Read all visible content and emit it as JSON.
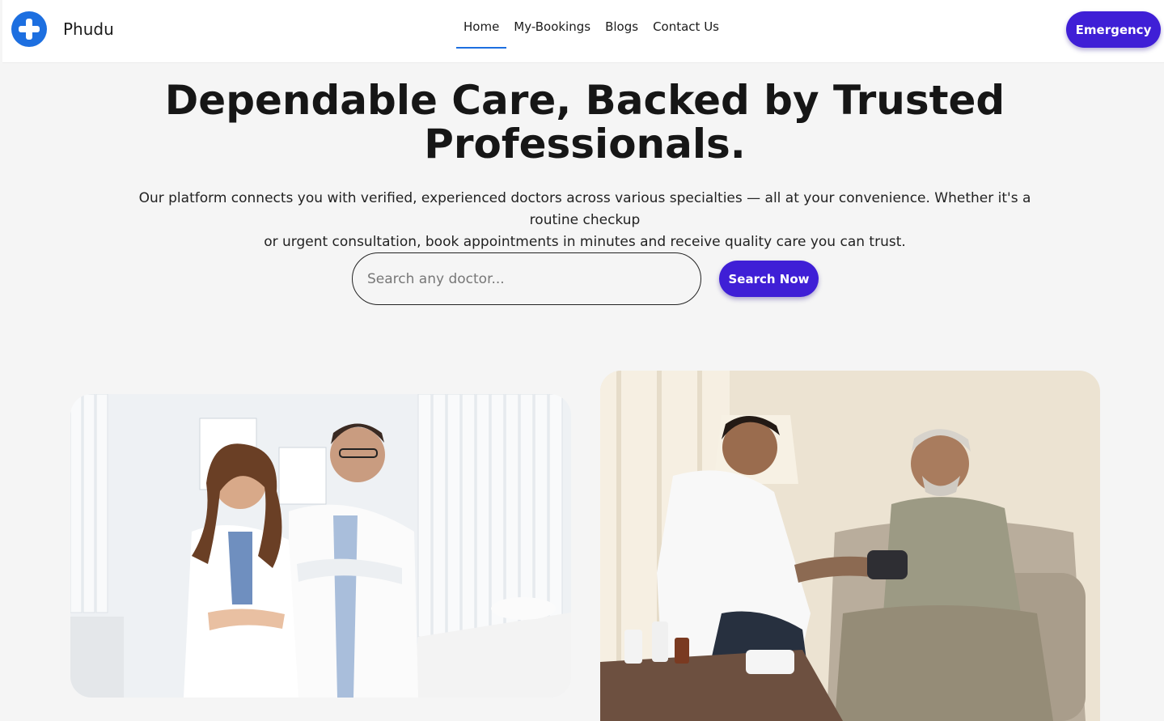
{
  "brand": {
    "name": "Phudu",
    "logo_icon": "plus-cross-icon",
    "logo_color": "#1d6fe0"
  },
  "nav": {
    "items": [
      {
        "label": "Home",
        "active": true
      },
      {
        "label": "My-Bookings",
        "active": false
      },
      {
        "label": "Blogs",
        "active": false
      },
      {
        "label": "Contact Us",
        "active": false
      }
    ],
    "emergency_label": "Emergency"
  },
  "hero": {
    "title_line1": "Dependable Care, Backed by Trusted",
    "title_line2": "Professionals.",
    "description_line1": "Our platform connects you with verified, experienced doctors across various specialties — all at your convenience. Whether it's a routine checkup",
    "description_line2": "or urgent consultation, book appointments in minutes and receive quality care you can trust."
  },
  "search": {
    "placeholder": "Search any doctor...",
    "value": "",
    "button_label": "Search Now"
  },
  "colors": {
    "accent": "#3f1fd6",
    "page_background": "#f5f5f5",
    "nav_active_underline": "#1d6fe0"
  }
}
